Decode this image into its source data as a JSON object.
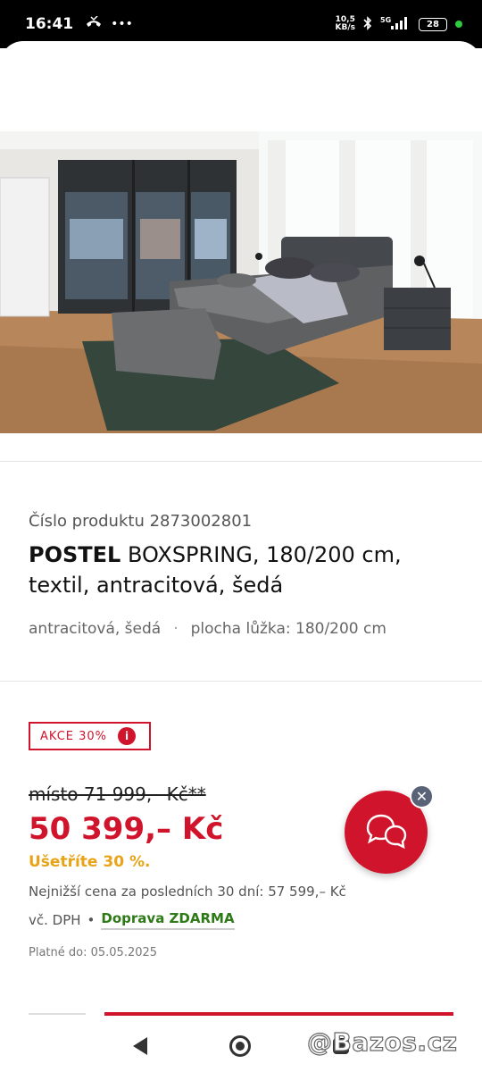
{
  "status": {
    "time": "16:41",
    "net_speed_top": "10,5",
    "net_speed_bottom": "KB/s",
    "signal": "5G",
    "battery": "28"
  },
  "product": {
    "number_label": "Číslo produktu 2873002801",
    "title_bold": "POSTEL",
    "title_rest": " BOXSPRING, 180/200 cm, textil, antracitová, šedá",
    "attr_color": "antracitová, šedá",
    "attr_sep": "·",
    "attr_size": "plocha lůžka: 180/200 cm"
  },
  "pricing": {
    "badge": "AKCE 30%",
    "badge_info": "i",
    "old_price": "místo 71 999,– Kč**",
    "price": "50 399,– Kč",
    "savings": "Ušetříte 30 %.",
    "lowest": "Nejnižší cena za posledních 30 dní: 57 599,– Kč",
    "vat": "vč. DPH",
    "bullet": "•",
    "shipping": "Doprava ZDARMA",
    "valid_until": "Platné do: 05.05.2025"
  },
  "chat": {
    "close": "✕"
  },
  "watermark": "@Bazos.cz",
  "colors": {
    "brand_red": "#d0142c",
    "savings_yellow": "#e8a317",
    "shipping_green": "#2d7a17"
  }
}
